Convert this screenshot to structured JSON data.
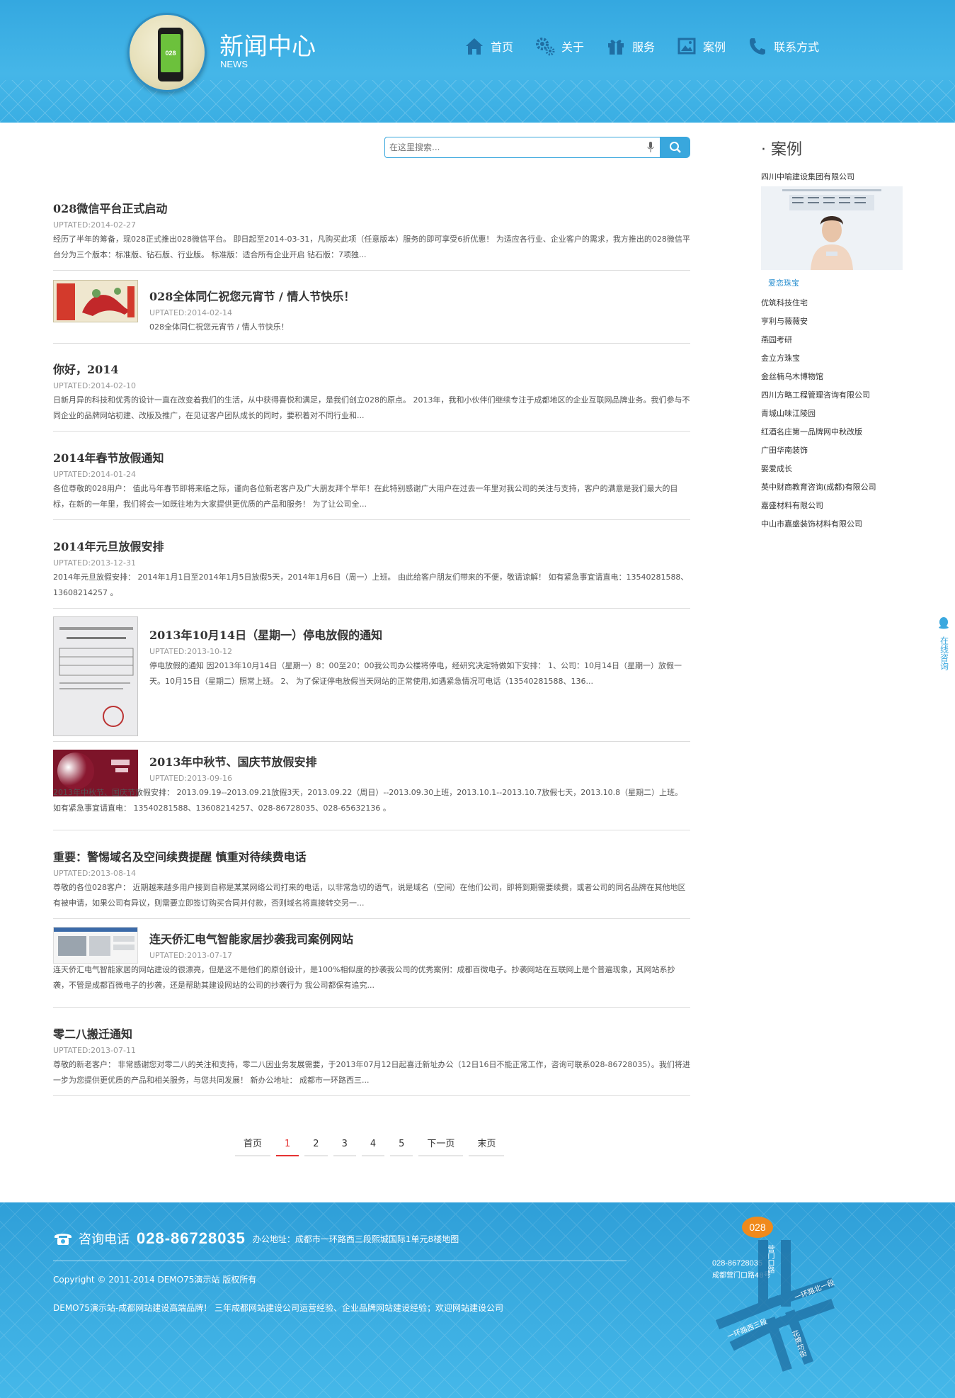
{
  "header": {
    "title": "新闻中心",
    "subtitle": "NEWS",
    "logo_text": "028",
    "nav": [
      {
        "label": "首页",
        "icon": "home-icon"
      },
      {
        "label": "关于",
        "icon": "gears-icon"
      },
      {
        "label": "服务",
        "icon": "gift-icon"
      },
      {
        "label": "案例",
        "icon": "picture-icon"
      },
      {
        "label": "联系方式",
        "icon": "phone-icon"
      }
    ]
  },
  "search": {
    "placeholder": "在这里搜索..."
  },
  "news": [
    {
      "title": "028微信平台正式启动",
      "date": "UPTATED:2014-02-27",
      "desc": "经历了半年的筹备，现028正式推出028微信平台。 即日起至2014-03-31，凡购买此项（任意版本）服务的即可享受6折优惠！ 为适应各行业、企业客户的需求，我方推出的028微信平台分为三个版本：标准版、钻石版、行业版。 标准版：适合所有企业开启 钻石版：7项独..."
    },
    {
      "title": "028全体同仁祝您元宵节 / 情人节快乐！",
      "date": "UPTATED:2014-02-14",
      "desc": "028全体同仁祝您元宵节 / 情人节快乐！"
    },
    {
      "title": "你好，2014",
      "date": "UPTATED:2014-02-10",
      "desc": "日新月异的科技和优秀的设计一直在改变着我们的生活，从中获得喜悦和满足，是我们创立028的原点。 2013年，我和小伙伴们继续专注于成都地区的企业互联网品牌业务。我们参与不同企业的品牌网站初建、改版及推广，在见证客户团队成长的同时，要积着对不同行业和..."
    },
    {
      "title": "2014年春节放假通知",
      "date": "UPTATED:2014-01-24",
      "desc": "各位尊敬的028用户： 值此马年春节即将来临之际，谨向各位新老客户及广大朋友拜个早年！在此特别感谢广大用户在过去一年里对我公司的关注与支持，客户的满意是我们最大的目标，在新的一年里，我们将会一如既往地为大家提供更优质的产品和服务！ 为了让公司全..."
    },
    {
      "title": "2014年元旦放假安排",
      "date": "UPTATED:2013-12-31",
      "desc": "2014年元旦放假安排： 2014年1月1日至2014年1月5日放假5天，2014年1月6日（周一）上班。 由此给客户朋友们带来的不便，敬请谅解！ 如有紧急事宜请直电：13540281588、13608214257 。"
    },
    {
      "title": "2013年10月14日（星期一）停电放假的通知",
      "date": "UPTATED:2013-10-12",
      "desc": "停电放假的通知 因2013年10月14日（星期一）8：00至20：00我公司办公楼将停电，经研究决定特做如下安排： 1、公司：10月14日（星期一）放假一天。10月15日（星期二）照常上班。 2、 为了保证停电放假当天网站的正常使用,如遇紧急情况可电话（13540281588、136..."
    },
    {
      "title": "2013年中秋节、国庆节放假安排",
      "date": "UPTATED:2013-09-16",
      "desc": "2013年中秋节、国庆节放假安排： 2013.09.19--2013.09.21放假3天，2013.09.22（周日）--2013.09.30上班，2013.10.1--2013.10.7放假七天，2013.10.8（星期二）上班。 如有紧急事宜请直电： 13540281588、13608214257、028-86728035、028-65632136 。"
    },
    {
      "title": "重要：警惕域名及空间续费提醒 慎重对待续费电话",
      "date": "UPTATED:2013-08-14",
      "desc": "尊敬的各位028客户： 近期越来越多用户接到自称是某某网络公司打来的电话，以非常急切的语气，说是域名（空间）在他们公司，即将到期需要续费，或者公司的同名品牌在其他地区有被申请，如果公司有异议，则需要立即签订购买合同并付款，否则域名将直接转交另一..."
    },
    {
      "title": "连天侨汇电气智能家居抄袭我司案例网站",
      "date": "UPTATED:2013-07-17",
      "desc": "连天侨汇电气智能家居的网站建设的很漂亮，但是这不是他们的原创设计，是100%相似度的抄袭我公司的优秀案例：成都百微电子。抄袭网站在互联网上是个普遍现象，其网站系抄袭，不管是成都百微电子的抄袭，还是帮助其建设网站的公司的抄袭行为 我公司都保有追究..."
    },
    {
      "title": "零二八搬迁通知",
      "date": "UPTATED:2013-07-11",
      "desc": "尊敬的新老客户： 非常感谢您对零二八的关注和支持，零二八因业务发展需要，于2013年07月12日起喜迁新址办公（12日16日不能正常工作，咨询可联系028-86728035）。我们将进一步为您提供更优质的产品和相关服务，与您共同发展！ 新办公地址： 成都市一环路西三..."
    }
  ],
  "pager": [
    "首页",
    "1",
    "2",
    "3",
    "4",
    "5",
    "下一页",
    "末页"
  ],
  "sidebar": {
    "title": "· 案例",
    "first": "四川中喻建设集团有限公司",
    "caption": "爱恋珠宝",
    "items": [
      "优筑科技住宅",
      "亨利与薇薇安",
      "燕园考研",
      "金立方珠宝",
      "金丝楠乌木博物馆",
      "四川方略工程管理咨询有限公司",
      "青城山味江陵园",
      "红酒名庄第一品牌网中秋改版",
      "广田华南装饰",
      "娶爱成长",
      "英中财商教育咨询(成都)有限公司",
      "嘉盛材料有限公司",
      "中山市嘉盛装饰材料有限公司"
    ]
  },
  "float": {
    "label": "在线咨询"
  },
  "footer": {
    "phone_label": "咨询电话",
    "phone_num": "028-86728035",
    "address": "办公地址：成都市一环路西三段熙城国际1单元8楼地图",
    "copyright": "Copyright © 2011-2014 DEMO75演示站 版权所有",
    "desc": "DEMO75演示站-成都网站建设高端品牌！ 三年成都网站建设公司运营经验、企业品牌网站建设经验；欢迎网站建设公司",
    "map_badge": "028",
    "map_phone": "028-86728035",
    "map_addr": "成都营门口路48号",
    "map_roads": [
      "营门口路",
      "一环路北一段",
      "一环路西三段",
      "花牌坊街"
    ]
  }
}
